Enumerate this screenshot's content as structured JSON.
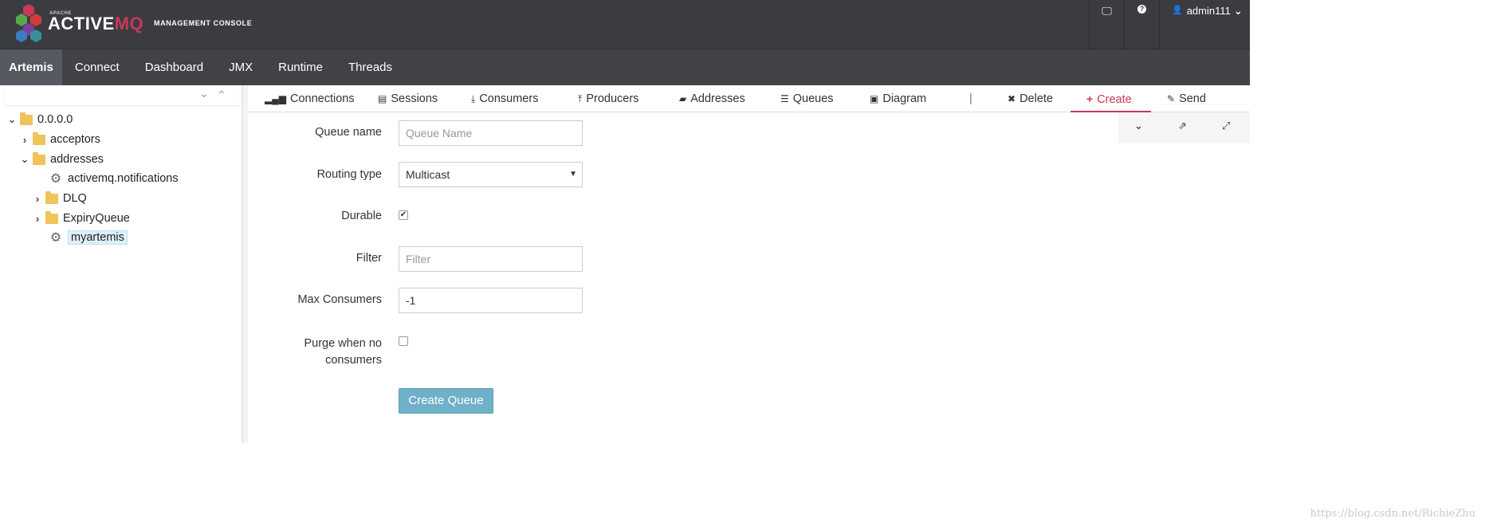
{
  "header": {
    "apache": "APACHE",
    "brand_a": "ACTIVE",
    "brand_b": "MQ",
    "console": "MANAGEMENT CONSOLE",
    "user": "admin111"
  },
  "nav": {
    "items": [
      "Artemis",
      "Connect",
      "Dashboard",
      "JMX",
      "Runtime",
      "Threads"
    ]
  },
  "tree": {
    "root": "0.0.0.0",
    "acceptors": "acceptors",
    "addresses": "addresses",
    "notifications": "activemq.notifications",
    "dlq": "DLQ",
    "expiry": "ExpiryQueue",
    "myartemis": "myartemis"
  },
  "tabs": {
    "connections": "Connections",
    "sessions": "Sessions",
    "consumers": "Consumers",
    "producers": "Producers",
    "addresses": "Addresses",
    "queues": "Queues",
    "diagram": "Diagram",
    "separator": "|",
    "delete": "Delete",
    "create": "Create",
    "send": "Send"
  },
  "form": {
    "queue_name_label": "Queue name",
    "queue_name_placeholder": "Queue Name",
    "routing_label": "Routing type",
    "routing_value": "Multicast",
    "durable_label": "Durable",
    "durable_checked": true,
    "filter_label": "Filter",
    "filter_placeholder": "Filter",
    "max_consumers_label": "Max Consumers",
    "max_consumers_value": "-1",
    "purge_label_1": "Purge when no",
    "purge_label_2": "consumers",
    "purge_checked": false,
    "create_button": "Create Queue"
  },
  "watermark": "https://blog.csdn.net/RichieZhu",
  "colors": {
    "accent": "#c8385b",
    "header_bg": "#3a3c40",
    "nav_bg": "#404246",
    "button": "#6fb1c8"
  }
}
